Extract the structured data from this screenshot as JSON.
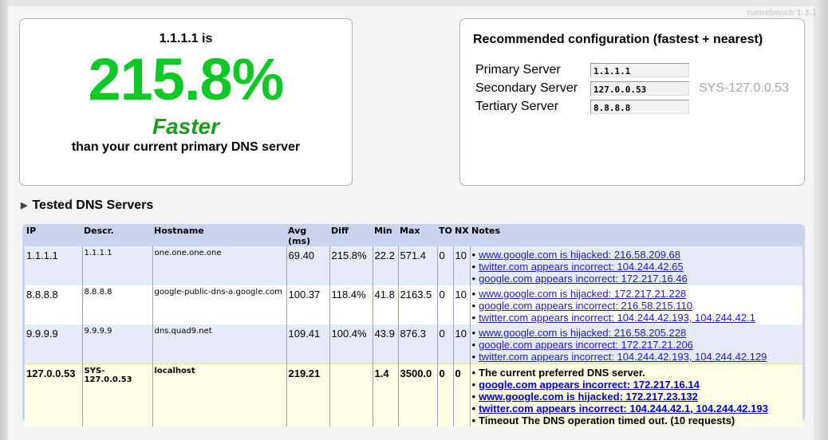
{
  "app": {
    "version": "namebench 1.3.1"
  },
  "headline": {
    "server": "1.1.1.1 is",
    "percent": "215.8%",
    "faster": "Faster",
    "comparison": "than your current primary DNS server"
  },
  "recommended": {
    "title": "Recommended configuration (fastest + nearest)",
    "rows": [
      {
        "label": "Primary Server",
        "value": "1.1.1.1",
        "name": ""
      },
      {
        "label": "Secondary Server",
        "value": "127.0.0.53",
        "name": "SYS-127.0.0.53"
      },
      {
        "label": "Tertiary Server",
        "value": "8.8.8.8",
        "name": ""
      }
    ]
  },
  "tested": {
    "title": "Tested DNS Servers",
    "columns": [
      "IP",
      "Descr.",
      "Hostname",
      "Avg (ms)",
      "Diff",
      "Min",
      "Max",
      "TO",
      "NX",
      "Notes"
    ],
    "rows": [
      {
        "ip": "1.1.1.1",
        "descr": "1.1.1.1",
        "hostname": "one.one.one.one",
        "avg": "69.40",
        "diff": "215.8%",
        "min": "22.2",
        "max": "571.4",
        "to": "0",
        "nx": "10",
        "notes": [
          "www.google.com is hijacked: 216.58.209.68",
          "twitter.com appears incorrect: 104.244.42.65",
          "google.com appears incorrect: 172.217.16.46"
        ]
      },
      {
        "ip": "8.8.8.8",
        "descr": "8.8.8.8",
        "hostname": "google-public-dns-a.google.com",
        "avg": "100.37",
        "diff": "118.4%",
        "min": "41.8",
        "max": "2163.5",
        "to": "0",
        "nx": "10",
        "notes": [
          "www.google.com is hijacked: 172.217.21.228",
          "google.com appears incorrect: 216.58.215.110",
          "twitter.com appears incorrect: 104.244.42.193, 104.244.42.1"
        ]
      },
      {
        "ip": "9.9.9.9",
        "descr": "9.9.9.9",
        "hostname": "dns.quad9.net",
        "avg": "109.41",
        "diff": "100.4%",
        "min": "43.9",
        "max": "876.3",
        "to": "0",
        "nx": "10",
        "notes": [
          "www.google.com is hijacked: 216.58.205.228",
          "google.com appears incorrect: 172.217.21.206",
          "twitter.com appears incorrect: 104.244.42.193, 104.244.42.129"
        ]
      },
      {
        "ip": "127.0.0.53",
        "descr": "SYS-127.0.0.53",
        "hostname": "localhost",
        "avg": "219.21",
        "diff": "",
        "min": "1.4",
        "max": "3500.0",
        "to": "0",
        "nx": "0",
        "notes_plain_first": "The current preferred DNS server.",
        "notes": [
          "google.com appears incorrect: 172.217.16.14",
          "www.google.com is hijacked: 172.217.23.132",
          "twitter.com appears incorrect: 104.244.42.1, 104.244.42.193"
        ],
        "notes_plain_last": "Timeout The DNS operation timed out. (10 requests)"
      }
    ]
  },
  "colors": {
    "accent_green": "#0ec825",
    "faster_green": "#1a9d1a",
    "table_header": "#c9d2ef",
    "row_alt": "#e7ebf7",
    "current_row": "#fefee4",
    "link": "#1a1ac8"
  }
}
